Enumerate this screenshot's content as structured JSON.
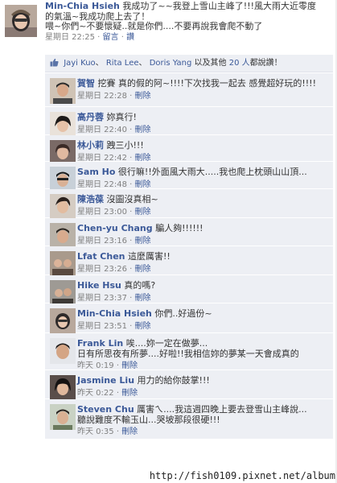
{
  "post": {
    "author": "Min-Chia Hsieh",
    "message_line1": "我成功了~~我登上雪山主峰了!!!風大雨大近零度",
    "message_line2": "的氣溫~我成功爬上去了！",
    "message_line3": "喂~你們~不要懷疑..就是你們....不要再說我會爬不動了",
    "timestamp": "星期日 22:25",
    "actions": [
      "留言",
      "讚"
    ],
    "avatar_icon": "user-avatar-icon"
  },
  "likes": {
    "icon": "thumbs-up-icon",
    "names": [
      "Jayi Kuo",
      "Rita Lee",
      "Doris Yang"
    ],
    "suffix_pre": "以及其他",
    "others_link": "20 人",
    "suffix_post": "都說讚！"
  },
  "comments": [
    {
      "author": "賀智",
      "text": "挖賽 真的假的阿~!!!!下次找我一起去 感覺超好玩的!!!!",
      "time": "星期日 22:28",
      "action": "刪除"
    },
    {
      "author": "高丹蓉",
      "text": "妳真行!",
      "time": "星期日 22:40",
      "action": "刪除"
    },
    {
      "author": "林小莉",
      "text": "跩三小!!!",
      "time": "星期日 22:42",
      "action": "刪除"
    },
    {
      "author": "Sam Ho",
      "text": "很行嘛!!外面風大雨大.....我也爬上枕頭山山頂...",
      "time": "星期日 22:48",
      "action": "刪除"
    },
    {
      "author": "陳浩葆",
      "text": "沒圖沒真相~",
      "time": "星期日 23:00",
      "action": "刪除"
    },
    {
      "author": "Chen-yu Chang",
      "text": "騙人夠!!!!!!",
      "time": "星期日 23:16",
      "action": "刪除"
    },
    {
      "author": "Lfat Chen",
      "text": "這麼厲害!!",
      "time": "星期日 23:26",
      "action": "刪除"
    },
    {
      "author": "Hike Hsu",
      "text": "真的嗎?",
      "time": "星期日 23:37",
      "action": "刪除"
    },
    {
      "author": "Min-Chia Hsieh",
      "text": "你們..好過份~",
      "time": "星期日 23:51",
      "action": "刪除"
    },
    {
      "author": "Frank Lin",
      "text": "唉....妳一定在做夢...",
      "text2": "日有所思夜有所夢....好啦!!我相信妳的夢某一天會成真的",
      "time": "昨天 0:19",
      "action": "刪除"
    },
    {
      "author": "Jasmine Liu",
      "text": "用力的給你鼓掌!!!",
      "time": "昨天 0:22",
      "action": "刪除"
    },
    {
      "author": "Steven Chu",
      "text": "厲害ㄟ....我這週四晚上要去登雪山主峰說...",
      "text2": "聽說難度不輸玉山...哭坡那段很硬!!!",
      "time": "昨天 0:35",
      "action": "刪除"
    }
  ],
  "watermark": "http://fish0109.pixnet.net/album",
  "colors": {
    "link": "#3b5998",
    "comment_bg": "#edeff4",
    "meta": "#808080"
  }
}
